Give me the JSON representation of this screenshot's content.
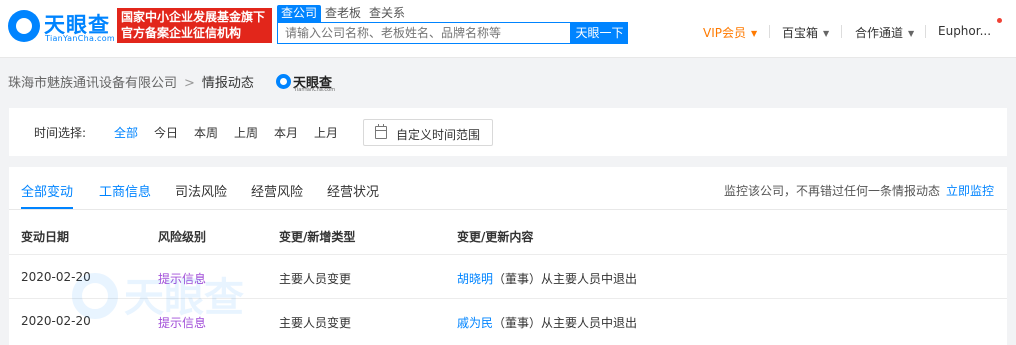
{
  "header": {
    "logo_text": "天眼查",
    "logo_sub": "TianYanCha.com",
    "banner_line1": "国家中小企业发展基金旗下",
    "banner_line2": "官方备案企业征信机构",
    "search_tabs": [
      "查公司",
      "查老板",
      "查关系"
    ],
    "search_placeholder": "请输入公司名称、老板姓名、品牌名称等",
    "search_button": "天眼一下",
    "nav": {
      "vip": "VIP会员",
      "treasure": "百宝箱",
      "cooperation": "合作通道",
      "user": "Euphor..."
    }
  },
  "breadcrumb": {
    "company": "珠海市魅族通讯设备有限公司",
    "separator": ">",
    "current": "情报动态",
    "logo_text": "天眼查",
    "logo_sub": "TianYanCha.com"
  },
  "filter": {
    "label": "时间选择:",
    "options": [
      "全部",
      "今日",
      "本周",
      "上周",
      "本月",
      "上月"
    ],
    "selected": "全部",
    "custom_range": "自定义时间范围"
  },
  "tabs": [
    "全部变动",
    "工商信息",
    "司法风险",
    "经营风险",
    "经营状况"
  ],
  "active_tab": "全部变动",
  "monitor": {
    "text": "监控该公司，不再错过任何一条情报动态",
    "link": "立即监控"
  },
  "table": {
    "columns": [
      "变动日期",
      "风险级别",
      "变更/新增类型",
      "变更/更新内容"
    ],
    "rows": [
      {
        "date": "2020-02-20",
        "risk": "提示信息",
        "type": "主要人员变更",
        "person": "胡晓明",
        "detail": "（董事）从主要人员中退出"
      },
      {
        "date": "2020-02-20",
        "risk": "提示信息",
        "type": "主要人员变更",
        "person": "戚为民",
        "detail": "（董事）从主要人员中退出"
      }
    ]
  },
  "watermark": {
    "text": "天眼查",
    "sub": "TianYanCha.com"
  },
  "colors": {
    "brand_blue": "#0084ff",
    "banner_red": "#e2261b",
    "vip_orange": "#ff7a00",
    "risk_purple": "#a24fd8"
  }
}
